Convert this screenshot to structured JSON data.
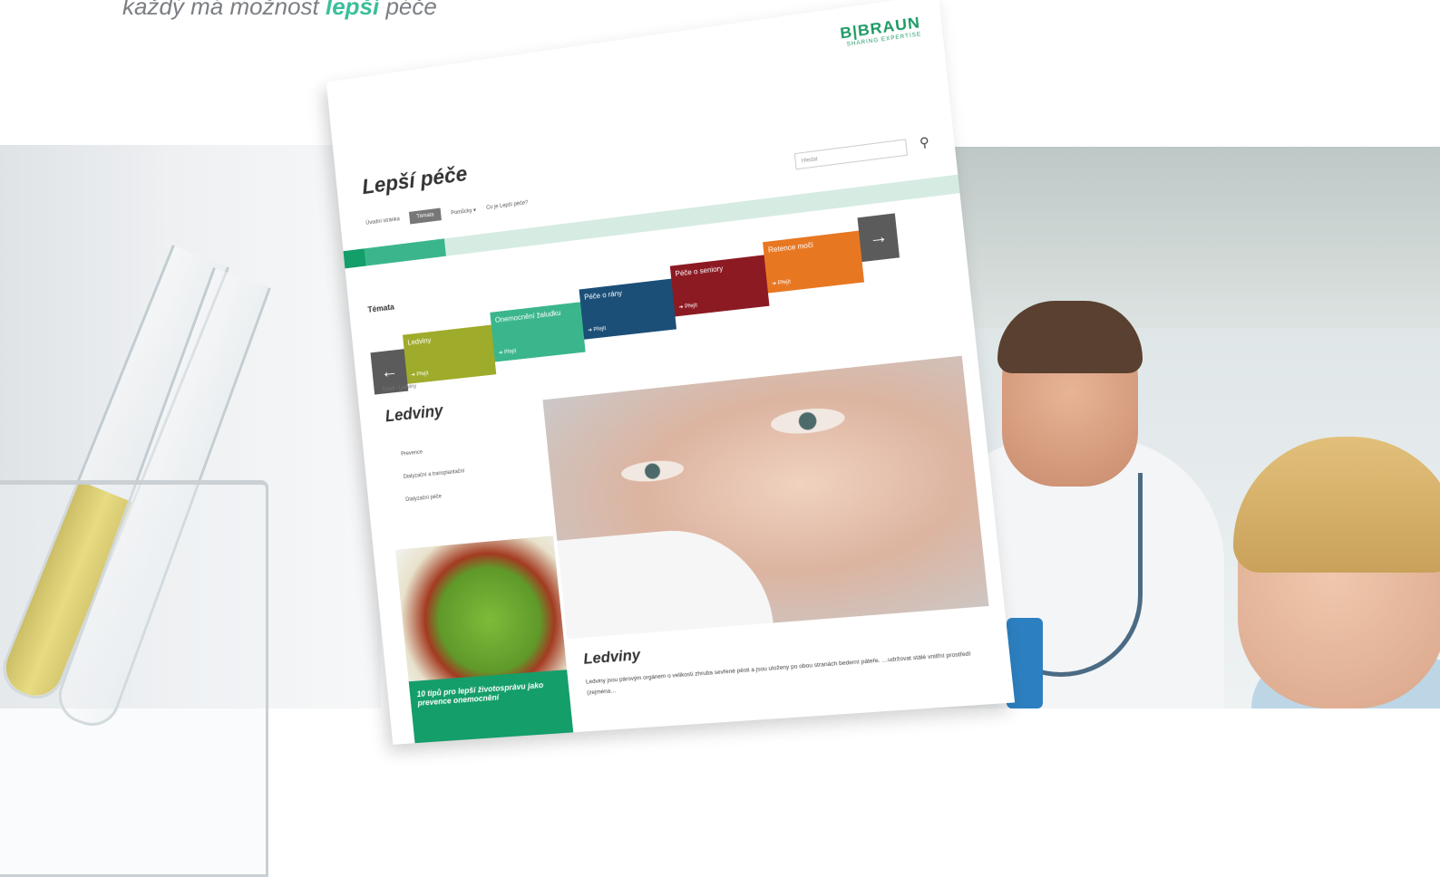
{
  "tagline": {
    "prefix": "každý má možnost ",
    "accent": "lepší",
    "suffix": " péče"
  },
  "logo": {
    "name": "B|BRAUN",
    "sub": "SHARING EXPERTISE"
  },
  "site": {
    "title": "Lepší péče",
    "nav": [
      "Úvodní stránka",
      "Témata",
      "Pomůcky ▾",
      "Co je Lepší péče?"
    ],
    "search_placeholder": "Hledat"
  },
  "topics": {
    "label": "Témata",
    "prev_arrow": "←",
    "next_arrow": "→",
    "go_label": "➜ Přejít",
    "tiles": [
      {
        "label": "Ledviny",
        "color": "#9fab2a"
      },
      {
        "label": "Onemocnění žaludku",
        "color": "#3bb68c"
      },
      {
        "label": "Péče o rány",
        "color": "#1b4f78"
      },
      {
        "label": "Péče o seniory",
        "color": "#8c1a23"
      },
      {
        "label": "Retence moči",
        "color": "#e87722"
      }
    ]
  },
  "breadcrumb": "Úvod › Ledviny",
  "section_title": "Ledviny",
  "side_links": [
    "Prevence",
    "Dialyzační a transplantační",
    "Dialyzační péče"
  ],
  "promo": "10 tipů pro lepší životosprávu jako prevence onemocnění",
  "article": {
    "title": "Ledviny",
    "text": "Ledviny jsou párovým orgánem o velikosti zhruba sevřené pěsti a jsou uloženy po obou stranách bederní páteře. …udržovat stálé vnitřní prostředí (zejména…"
  }
}
